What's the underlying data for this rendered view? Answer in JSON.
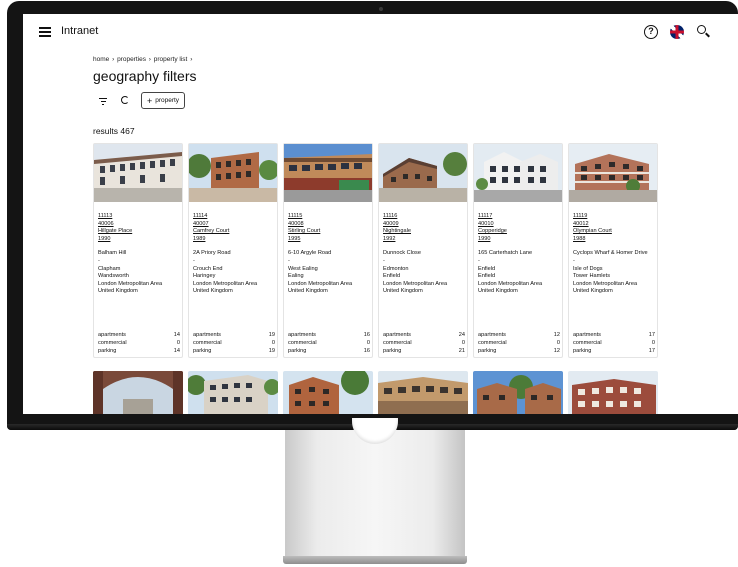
{
  "app": {
    "title": "Intranet"
  },
  "breadcrumb": [
    "home",
    "properties",
    "property list"
  ],
  "breadcrumb_separator": "›",
  "page_title": "geography filters",
  "toolbar": {
    "add_property_label": "property",
    "add_symbol": "+"
  },
  "results_label": "results 467",
  "help_symbol": "?",
  "count_labels": {
    "apartments": "apartments",
    "commercial": "commercial",
    "parking": "parking"
  },
  "cards": [
    {
      "id": "11113",
      "code": "40006",
      "name": "Hillgate Place",
      "year": "1990",
      "address": [
        "Balham Hill",
        "-",
        "Clapham",
        "Wandsworth",
        "London Metropolitan Area",
        "United Kingdom"
      ],
      "apartments": "14",
      "commercial": "0",
      "parking": "14"
    },
    {
      "id": "11114",
      "code": "40007",
      "name": "Camfrey Court",
      "year": "1989",
      "address": [
        "2A Priory Road",
        "-",
        "Crouch End",
        "Haringey",
        "London Metropolitan Area",
        "United Kingdom"
      ],
      "apartments": "19",
      "commercial": "0",
      "parking": "19"
    },
    {
      "id": "11115",
      "code": "40008",
      "name": "Stirling Court",
      "year": "1995",
      "address": [
        "6-10 Argyle Road",
        "-",
        "West Ealing",
        "Ealing",
        "London Metropolitan Area",
        "United Kingdom"
      ],
      "apartments": "16",
      "commercial": "0",
      "parking": "16"
    },
    {
      "id": "11116",
      "code": "40009",
      "name": "Nightingale",
      "year": "1992",
      "address": [
        "Dunnock Close",
        "-",
        "Edmonton",
        "Enfield",
        "London Metropolitan Area",
        "United Kingdom"
      ],
      "apartments": "24",
      "commercial": "0",
      "parking": "21"
    },
    {
      "id": "11117",
      "code": "40010",
      "name": "Copperidge",
      "year": "1990",
      "address": [
        "165 Carterhatch Lane",
        "-",
        "Enfield",
        "Enfield",
        "London Metropolitan Area",
        "United Kingdom"
      ],
      "apartments": "12",
      "commercial": "0",
      "parking": "12"
    },
    {
      "id": "11119",
      "code": "40012",
      "name": "Olympian Court",
      "year": "1988",
      "address": [
        "Cyclops Wharf & Homer Drive",
        "-",
        "Isle of Dogs",
        "Tower Hamlets",
        "London Metropolitan Area",
        "United Kingdom"
      ],
      "apartments": "17",
      "commercial": "0",
      "parking": "17"
    }
  ],
  "colors": {
    "bezel": "#141414",
    "screen": "#ffffff",
    "text": "#111111",
    "card_border": "#e4e4e4"
  },
  "icons": [
    "hamburger-menu-icon",
    "help-icon",
    "language-flag-icon",
    "search-icon",
    "filter-icon",
    "refresh-icon"
  ]
}
